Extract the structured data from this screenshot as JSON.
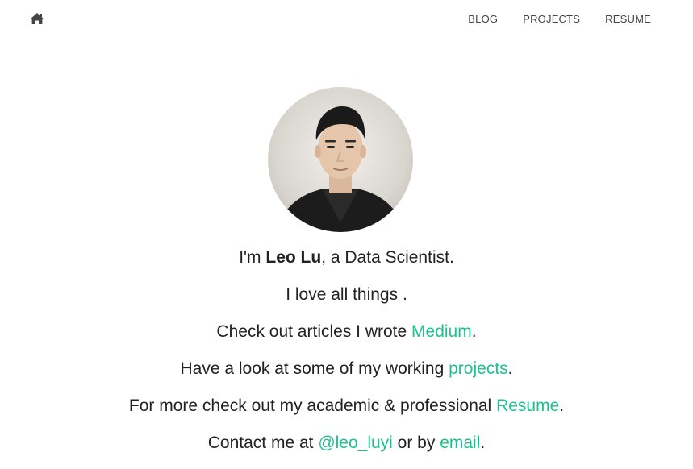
{
  "nav": {
    "home_icon": "home-icon",
    "items": [
      "BLOG",
      "PROJECTS",
      "RESUME"
    ]
  },
  "profile": {
    "avatar_alt": "profile-photo",
    "line1": {
      "pre": "I'm ",
      "name": "Leo Lu",
      "post": ", a Data Scientist."
    },
    "line2": {
      "text": "I love all things ."
    },
    "line3": {
      "pre": "Check out articles I wrote ",
      "link": "Medium",
      "post": "."
    },
    "line4": {
      "pre": "Have a look at some of my working ",
      "link": "projects",
      "post": "."
    },
    "line5": {
      "pre": "For more check out my academic & professional ",
      "link": "Resume",
      "post": "."
    },
    "line6": {
      "pre": "Contact me at ",
      "link1": "@leo_luyi",
      "mid": " or by ",
      "link2": "email",
      "post": "."
    }
  },
  "colors": {
    "link": "#1ec08f",
    "text": "#222222",
    "nav": "#444444"
  }
}
